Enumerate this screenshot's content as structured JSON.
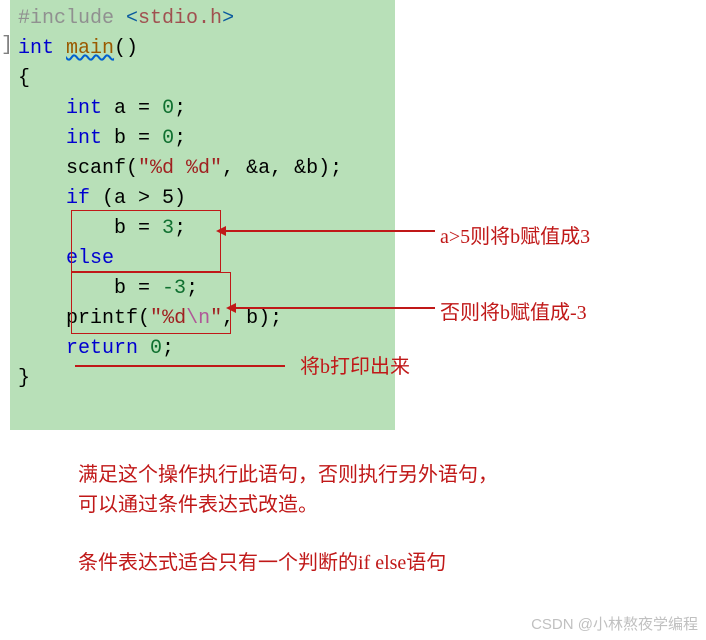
{
  "code": {
    "include_directive": "#include",
    "angle_open": "<",
    "header_name": "stdio.h",
    "angle_close": ">",
    "int_kw": "int",
    "main_name": "main",
    "parens": "()",
    "brace_open": "{",
    "decl_a": "    int a = 0;",
    "int_kw2": "int",
    "var_a": " a ",
    "eq": "=",
    "zero": " 0",
    "semicolon": ";",
    "int_kw3": "int",
    "var_b": " b ",
    "scanf_name": "scanf",
    "scanf_open": "(",
    "scanf_fmt": "\"%d %d\"",
    "comma": ", ",
    "amp_a": "&a",
    "amp_b": "&b",
    "scanf_close": ")",
    "if_kw": "if",
    "if_cond": " (a > 5)",
    "assign_b3": "        b = 3;",
    "b_assign": "b ",
    "three": " 3",
    "else_kw": "else",
    "neg3": " -3",
    "printf_name": "printf",
    "printf_fmt_open": "\"",
    "printf_d": "%d",
    "printf_esc": "\\n",
    "printf_fmt_close": "\"",
    "b_arg": "b",
    "return_kw": "return",
    "ret_zero": " 0",
    "brace_close": "}"
  },
  "annotations": {
    "ann1": "a>5则将b赋值成3",
    "ann2": "否则将b赋值成-3",
    "ann3": "将b打印出来"
  },
  "explain": {
    "exp1": "满足这个操作执行此语句，否则执行另外语句，可以通过条件表达式改造。",
    "exp2": "条件表达式适合只有一个判断的if else语句"
  },
  "watermark": "CSDN @小林熬夜学编程"
}
